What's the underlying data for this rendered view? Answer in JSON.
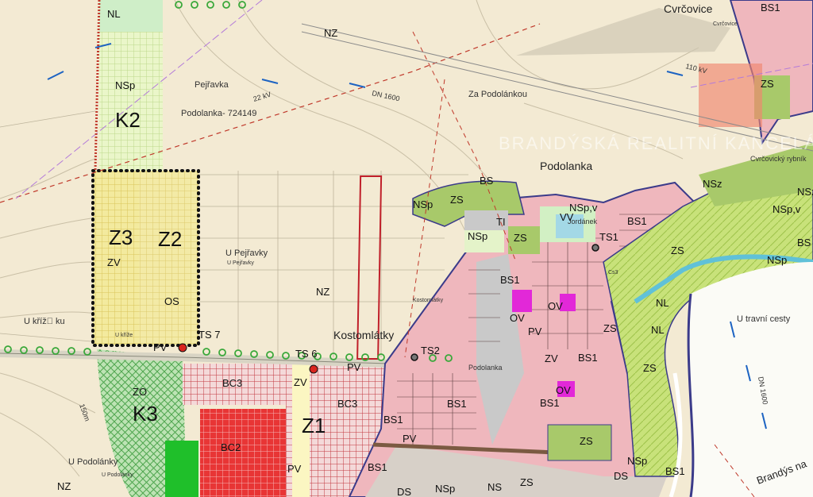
{
  "map": {
    "watermark": "BRANDÝSKÁ REALITNÍ KANCELÁŘ",
    "places": {
      "cvrcovice": "Cvrčovice",
      "podolanka": "Podolanka",
      "kostomlatky": "Kostomlátky",
      "u_pejravky": "U Pejřavky",
      "u_krize": "U kříž\u0000 ku",
      "u_travni_cesty": "U travní cesty",
      "u_podolanky": "U Podolánky",
      "za_podolankou": "Za Podolánkou",
      "pejravka": "Pejřavka",
      "podolanka_code": "Podolanka- 724149",
      "brandys": "Brandýs na",
      "cvrcovicky": "Cvrčovický rybník",
      "jordanek": "Jordánek",
      "small_u_pejravky": "U Pejřavky",
      "small_u_podolanky": "U Podolánky",
      "small_kostomlatky": "Kostomlátky",
      "small_podolanka": "Podolanka",
      "small_cvrcovice": "Cvrčovice",
      "small_krize": "U kříže",
      "small_lokalita": "Cs3"
    },
    "lines": {
      "kv22": "22 kV",
      "dn1600": "DN 1600",
      "kv110": "110 kV",
      "dn1600b": "DN 1600",
      "m150": "150m"
    },
    "reserves": {
      "k2": "K2",
      "k3": "K3",
      "z1": "Z1",
      "z2": "Z2",
      "z3": "Z3"
    },
    "codes": {
      "nl_top": "NL",
      "nsp_top": "NSp",
      "nz_top": "NZ",
      "zv_z3": "ZV",
      "os": "OS",
      "nz_mid": "NZ",
      "ts7": "TS 7",
      "ts6": "TS 6",
      "ts2": "TS2",
      "ts1": "TS1",
      "pv1": "PV",
      "pv2": "PV",
      "pv3": "PV",
      "pv4": "PV",
      "pv5": "PV",
      "zo": "ZO",
      "bc3a": "BC3",
      "bc3b": "BC3",
      "zv2": "ZV",
      "bc2": "BC2",
      "bs1a": "BS1",
      "bs1b": "BS1",
      "bs1c": "BS1",
      "bs1d": "BS1",
      "bs1e": "BS1",
      "bs1f": "BS1",
      "bs1g": "BS1",
      "bs1h": "BS1",
      "bs_green": "BS",
      "zs1": "ZS",
      "zs2": "ZS",
      "zs3": "ZS",
      "zs4": "ZS",
      "zs5": "ZS",
      "zs6": "ZS",
      "zs7": "ZS",
      "nsp1": "NSp",
      "nsp2": "NSp",
      "nsp3": "NSp",
      "nspv1": "NSp,v",
      "nspv2": "NSp,v",
      "nsp4": "NSp",
      "nsp5": "NSp",
      "ti": "TI",
      "vv": "VV",
      "ov1": "OV",
      "ov2": "OV",
      "ov3": "OV",
      "zv3": "ZV",
      "nl1": "NL",
      "nl2": "NL",
      "nsz": "NSz",
      "nz_bottom": "NZ",
      "ds1": "DS",
      "ds2": "DS",
      "ns": "NS",
      "bs_top": "BS",
      "nsz2": "NSz",
      "bs1_last": "BS1",
      "zs_bottom": "ZS"
    }
  }
}
